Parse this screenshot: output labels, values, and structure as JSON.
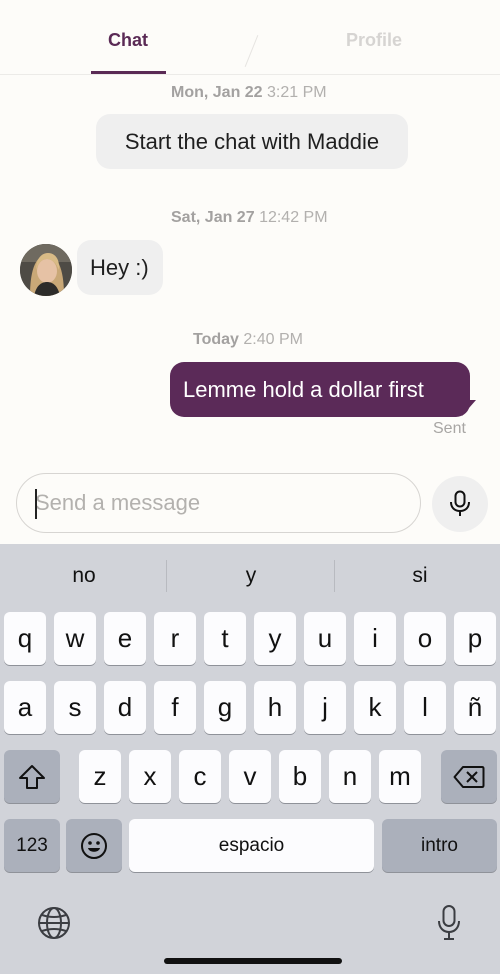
{
  "tabs": {
    "chat": "Chat",
    "profile": "Profile"
  },
  "conversation": {
    "timestamps": [
      {
        "day": "Mon, Jan 22",
        "time": "3:21 PM"
      },
      {
        "day": "Sat, Jan 27",
        "time": "12:42 PM"
      },
      {
        "day": "Today",
        "time": "2:40 PM"
      }
    ],
    "system_message": "Start the chat with Maddie",
    "incoming_message": "Hey :)",
    "outgoing_message": "Lemme hold a dollar first",
    "status": "Sent"
  },
  "composer": {
    "placeholder": "Send a message",
    "value": ""
  },
  "keyboard": {
    "suggestions": [
      "no",
      "y",
      "si"
    ],
    "row1": [
      "q",
      "w",
      "e",
      "r",
      "t",
      "y",
      "u",
      "i",
      "o",
      "p"
    ],
    "row2": [
      "a",
      "s",
      "d",
      "f",
      "g",
      "h",
      "j",
      "k",
      "l",
      "ñ"
    ],
    "row3": [
      "z",
      "x",
      "c",
      "v",
      "b",
      "n",
      "m"
    ],
    "numbers_label": "123",
    "space_label": "espacio",
    "return_label": "intro"
  },
  "colors": {
    "accent": "#5b2a58",
    "keyboard_bg": "#d1d3d9"
  }
}
